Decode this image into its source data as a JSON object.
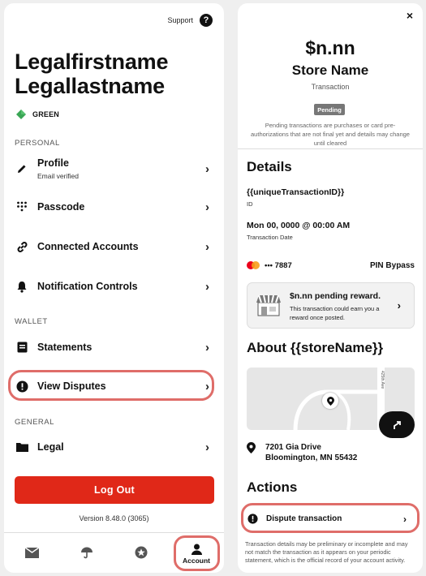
{
  "account": {
    "support_label": "Support",
    "name_line1": "Legalfirstname",
    "name_line2": "Legallastname",
    "tier": "GREEN",
    "sections": {
      "personal": "PERSONAL",
      "wallet": "WALLET",
      "general": "GENERAL"
    },
    "items": {
      "profile": {
        "label": "Profile",
        "sub": "Email verified"
      },
      "passcode": {
        "label": "Passcode"
      },
      "connected": {
        "label": "Connected Accounts"
      },
      "notifications": {
        "label": "Notification Controls"
      },
      "statements": {
        "label": "Statements"
      },
      "disputes": {
        "label": "View Disputes"
      },
      "legal": {
        "label": "Legal"
      }
    },
    "chevron": "›",
    "logout_label": "Log Out",
    "version": "Version 8.48.0 (3065)",
    "tabs": {
      "account_label": "Account"
    },
    "colors": {
      "accent_red": "#e02818",
      "tier_green": "#3aa655",
      "highlight": "#d9534f"
    }
  },
  "transaction": {
    "close": "×",
    "amount": "$n.nn",
    "store": "Store Name",
    "type": "Transaction",
    "status_badge": "Pending",
    "pending_note": "Pending transactions are purchases or card pre-authorizations that are not final yet and details may change until cleared",
    "details_heading": "Details",
    "txn_id_value": "{{uniqueTransactionID}}",
    "txn_id_label": "ID",
    "date_value": "Mon 00, 0000 @ 00:00 AM",
    "date_label": "Transaction Date",
    "card_last4": "••• 7887",
    "card_method": "PIN Bypass",
    "reward_title": "$n.nn pending reward.",
    "reward_text": "This transaction could earn you a reward once posted.",
    "about_heading": "About {{storeName}}",
    "map_street": "425th Ave",
    "address_line1": "7201 Gia Drive",
    "address_line2": "Bloomington, MN 55432",
    "actions_heading": "Actions",
    "dispute_label": "Dispute transaction",
    "chevron": "›",
    "disclaimer": "Transaction details may be preliminary or incomplete and may not match the transaction as it appears on your periodic statement, which is the official record of your account activity."
  }
}
